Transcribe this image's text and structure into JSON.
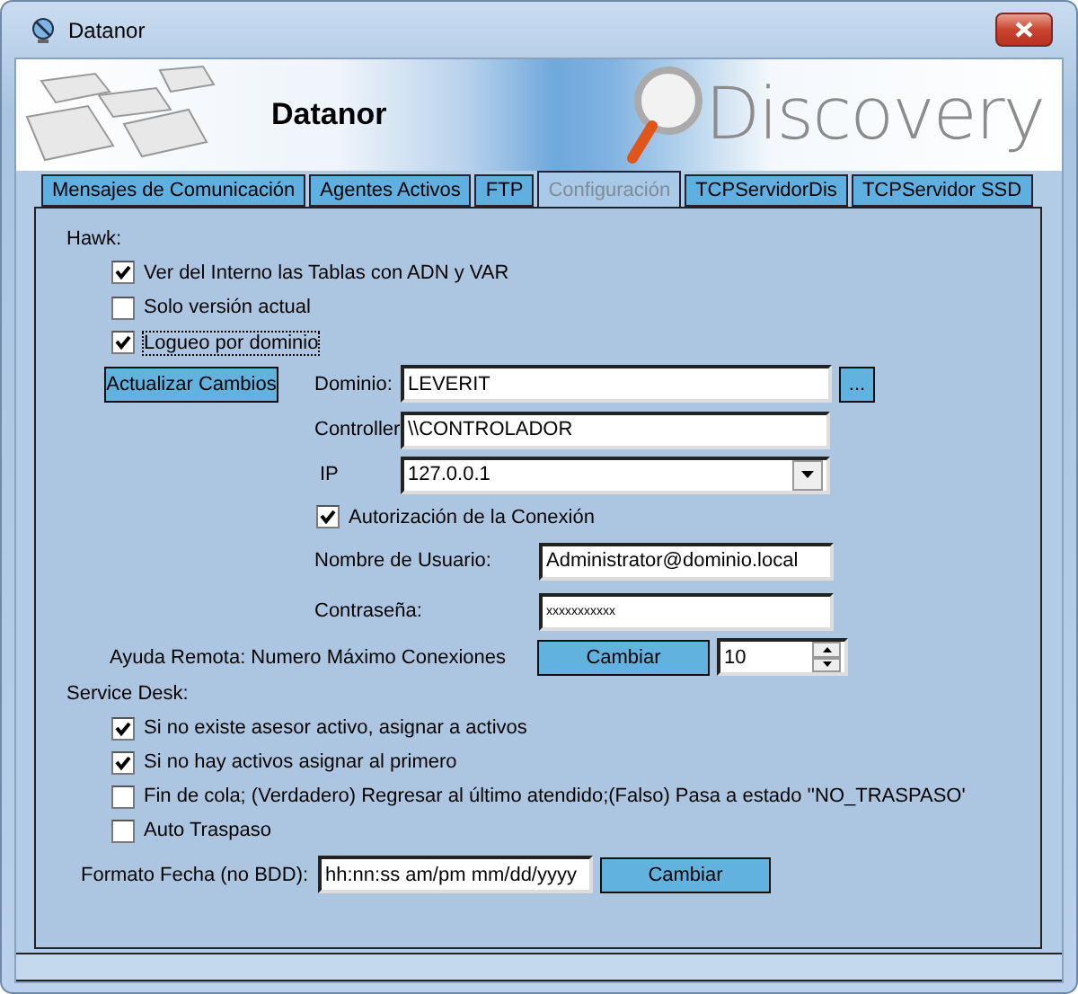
{
  "window": {
    "title": "Datanor"
  },
  "banner": {
    "title": "Datanor",
    "logo": "Discovery"
  },
  "tabs": [
    {
      "label": "Mensajes de Comunicación",
      "selected": false
    },
    {
      "label": "Agentes Activos",
      "selected": false
    },
    {
      "label": "FTP",
      "selected": false
    },
    {
      "label": "Configuración",
      "selected": true
    },
    {
      "label": "TCPServidorDis",
      "selected": false
    },
    {
      "label": "TCPServidor SSD",
      "selected": false
    }
  ],
  "hawk": {
    "label": "Hawk:",
    "options": [
      {
        "label": "Ver del Interno las Tablas con ADN y VAR",
        "checked": true,
        "focused": false
      },
      {
        "label": "Solo versión actual",
        "checked": false,
        "focused": false
      },
      {
        "label": "Logueo por dominio",
        "checked": true,
        "focused": true
      }
    ],
    "update_button": "Actualizar Cambios",
    "domain": {
      "label": "Dominio:",
      "value": "LEVERIT",
      "browse_button": "..."
    },
    "controller": {
      "label": "Controller",
      "value": "\\\\CONTROLADOR"
    },
    "ip": {
      "label": "IP",
      "value": "127.0.0.1"
    },
    "auth": {
      "label": "Autorización de la Conexión",
      "checked": true
    },
    "username": {
      "label": "Nombre de Usuario:",
      "value": "Administrator@dominio.local"
    },
    "password": {
      "label": "Contraseña:",
      "value": "xxxxxxxxxxx"
    }
  },
  "remote_help": {
    "label": "Ayuda Remota: Numero Máximo Conexiones",
    "button": "Cambiar",
    "value": "10"
  },
  "service_desk": {
    "label": "Service Desk:",
    "options": [
      {
        "label": "Si no existe asesor activo, asignar a activos",
        "checked": true
      },
      {
        "label": "Si no hay activos asignar al primero",
        "checked": true
      },
      {
        "label": "Fin de cola; (Verdadero) Regresar al último atendido;(Falso) Pasa a estado ''NO_TRASPASO'",
        "checked": false
      },
      {
        "label": "Auto Traspaso",
        "checked": false
      }
    ]
  },
  "date_format": {
    "label": "Formato Fecha (no BDD):",
    "value": "hh:nn:ss am/pm mm/dd/yyyy",
    "button": "Cambiar"
  }
}
